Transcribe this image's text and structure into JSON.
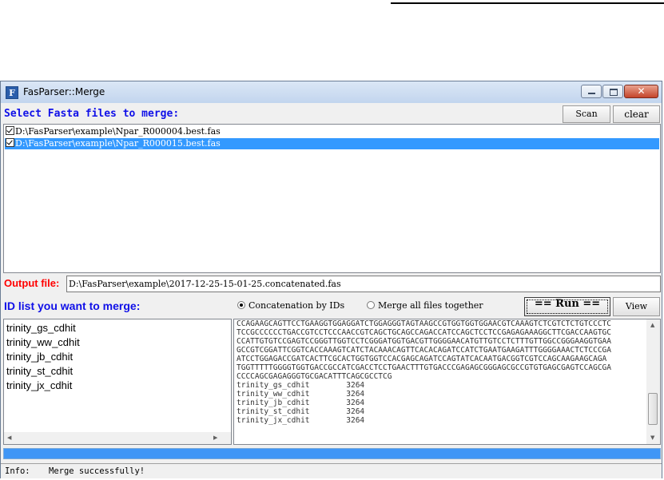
{
  "window": {
    "title": "FasParser::Merge",
    "app_icon": "fasparser-logo-icon",
    "controls": [
      "minimize-icon",
      "maximize-icon",
      "close-icon"
    ]
  },
  "fasta_section": {
    "label": "Select Fasta files to merge:",
    "scan_label": "Scan",
    "clear_label": "clear",
    "files": [
      {
        "path": "D:\\FasParser\\example\\Npar_R000004.best.fas",
        "checked": true,
        "selected": false
      },
      {
        "path": "D:\\FasParser\\example\\Npar_R000015.best.fas",
        "checked": true,
        "selected": true
      }
    ]
  },
  "output": {
    "label": "Output file:",
    "value": "D:\\FasParser\\example\\2017-12-25-15-01-25.concatenated.fas"
  },
  "id_section": {
    "label": "ID list you want to merge:",
    "ids": [
      "trinity_gs_cdhit",
      "trinity_ww_cdhit",
      "trinity_jb_cdhit",
      "trinity_st_cdhit",
      "trinity_jx_cdhit"
    ]
  },
  "mode": {
    "option1": "Concatenation by IDs",
    "option2": "Merge all files together",
    "selected": "option1"
  },
  "run_label": "== Run ==",
  "view_label": "View",
  "result_lines": [
    "CCAGAAGCAGTTCCTGAAGGTGGAGGATCTGGAGGGTAGTAAGCCGTGGTGGTGGAACGTCAAAGTCTCGTCTCTGTCCCTC",
    "TCCGCCCCCCTGACCGTCCTCCCAACCGTCAGCTGCAGCCAGACCATCCAGCTCCTCCGAGAGAAAGGCTTCGACCAAGTGC",
    "CCATTGTGTCCGAGTCCGGGTTGGTCCTCGGGATGGTGACGTTGGGGAACATGTTGTCCTCTTTGTTGGCCGGGAAGGTGAA",
    "GCCGTCGGATTCGGTCACCAAAGTCATCTACAAACAGTTCACACAGATCCATCTGAATGAAGATTTGGGGAAACTCTCCCGA",
    "ATCCTGGAGACCGATCACTTCGCACTGGTGGTCCACGAGCAGATCCAGTATCACAATGACGGTCGTCCAGCAAGAAGCAGA",
    "TGGTTTTTGGGGTGGTGACCGCCATCGACCTCCTGAACTTTGTGACCCGAGAGCGGGAGCGCCGTGTGAGCGAGTCCAGCGA",
    "CCCCAGCGAGAGGGTGCGACATTTCAGCGCCTCG",
    "trinity_gs_cdhit        3264",
    "trinity_ww_cdhit        3264",
    "trinity_jb_cdhit        3264",
    "trinity_st_cdhit        3264",
    "trinity_jx_cdhit        3264"
  ],
  "progress": 1.0,
  "status": {
    "label": "Info:",
    "message": "Merge successfully!"
  },
  "colors": {
    "section_label": "#1010e8",
    "output_label": "#ff0000",
    "selection": "#3399ff",
    "progress": "#3f96f6"
  }
}
